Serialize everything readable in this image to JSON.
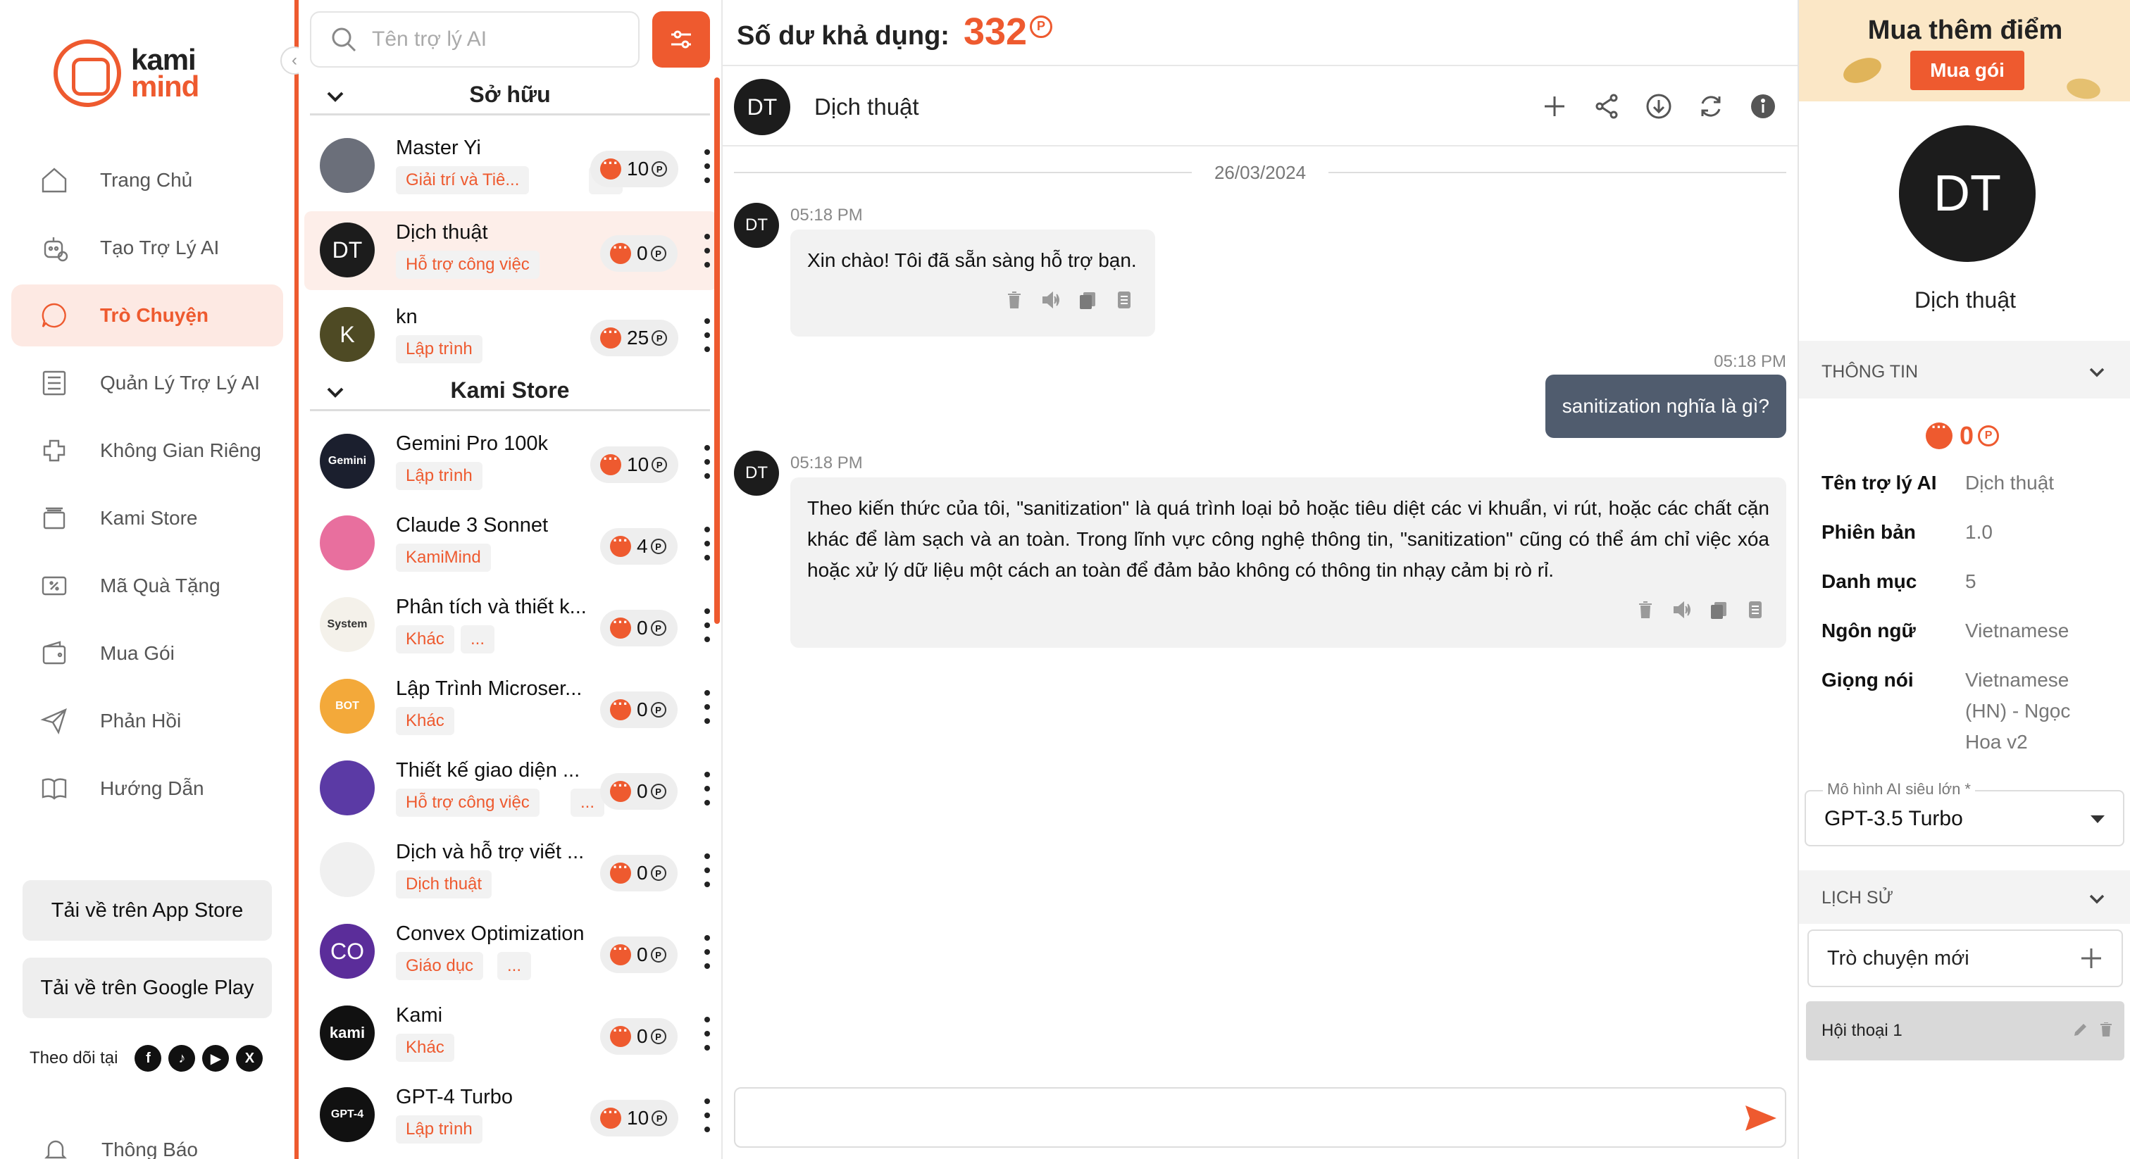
{
  "nav": {
    "logo_top": "kami",
    "logo_bottom": "mind",
    "items": [
      {
        "label": "Trang Chủ",
        "icon": "home-icon",
        "active": false
      },
      {
        "label": "Tạo Trợ Lý AI",
        "icon": "robot-icon",
        "active": false
      },
      {
        "label": "Trò Chuyện",
        "icon": "chat-icon",
        "active": true
      },
      {
        "label": "Quản Lý Trợ Lý AI",
        "icon": "list-icon",
        "active": false
      },
      {
        "label": "Không Gian Riêng",
        "icon": "puzzle-icon",
        "active": false
      },
      {
        "label": "Kami Store",
        "icon": "store-icon",
        "active": false
      },
      {
        "label": "Mã Quà Tặng",
        "icon": "voucher-icon",
        "active": false
      },
      {
        "label": "Mua Gói",
        "icon": "wallet-icon",
        "active": false
      },
      {
        "label": "Phản Hồi",
        "icon": "send-icon",
        "active": false
      },
      {
        "label": "Hướng Dẫn",
        "icon": "book-icon",
        "active": false
      }
    ],
    "app_store": "Tải về trên App Store",
    "google_play": "Tải về trên Google Play",
    "follow_label": "Theo dõi tại",
    "notification": "Thông Báo"
  },
  "assistants": {
    "search_placeholder": "Tên trợ lý AI",
    "owned_title": "Sở hữu",
    "store_title": "Kami Store",
    "owned": [
      {
        "name": "Master Yi",
        "tags": [
          "Giải trí và Tiê...",
          "..."
        ],
        "count": "10",
        "avatar": "",
        "av_color": "#6b6f7a"
      },
      {
        "name": "Dịch thuật",
        "tags": [
          "Hỗ trợ công việc"
        ],
        "count": "0",
        "avatar": "DT",
        "av_color": "#1c1c1c",
        "active": true
      },
      {
        "name": "kn",
        "tags": [
          "Lập trình"
        ],
        "count": "25",
        "avatar": "K",
        "av_color": "#4e4a24"
      }
    ],
    "store": [
      {
        "name": "Gemini Pro 100k",
        "tags": [
          "Lập trình"
        ],
        "count": "10",
        "avatar": "Gemini",
        "av_color": "#1b1f2e"
      },
      {
        "name": "Claude 3 Sonnet",
        "tags": [
          "KamiMind"
        ],
        "count": "4",
        "avatar": "",
        "av_color": "#e86f9e"
      },
      {
        "name": "Phân tích và thiết k...",
        "tags": [
          "Khác",
          "..."
        ],
        "count": "0",
        "avatar": "System",
        "av_color": "#f4f1ea"
      },
      {
        "name": "Lập Trình Microser...",
        "tags": [
          "Khác"
        ],
        "count": "0",
        "avatar": "BOT",
        "av_color": "#f3a93a"
      },
      {
        "name": "Thiết kế giao diện ...",
        "tags": [
          "Hỗ trợ công việc",
          "..."
        ],
        "count": "0",
        "avatar": "",
        "av_color": "#5b3aa5"
      },
      {
        "name": "Dịch và hỗ trợ viết ...",
        "tags": [
          "Dịch thuật"
        ],
        "count": "0",
        "avatar": "",
        "av_color": "#f0f0f0"
      },
      {
        "name": "Convex Optimization",
        "tags": [
          "Giáo dục",
          "..."
        ],
        "count": "0",
        "avatar": "CO",
        "av_color": "#5b2d9a"
      },
      {
        "name": "Kami",
        "tags": [
          "Khác"
        ],
        "count": "0",
        "avatar": "kami",
        "av_color": "#111111"
      },
      {
        "name": "GPT-4 Turbo",
        "tags": [
          "Lập trình"
        ],
        "count": "10",
        "avatar": "GPT-4",
        "av_color": "#111111"
      }
    ]
  },
  "chat": {
    "balance_label": "Số dư khả dụng:",
    "balance_value": "332",
    "coin_symbol": "P",
    "title": "Dịch thuật",
    "avatar": "DT",
    "date": "26/03/2024",
    "messages": [
      {
        "role": "bot",
        "time": "05:18 PM",
        "text": "Xin chào! Tôi đã sẵn sàng hỗ trợ bạn."
      },
      {
        "role": "user",
        "time": "05:18 PM",
        "text": "sanitization nghĩa là gì?"
      },
      {
        "role": "bot",
        "time": "05:18 PM",
        "text": "Theo kiến thức của tôi, \"sanitization\" là quá trình loại bỏ hoặc tiêu diệt các vi khuẩn, vi rút, hoặc các chất cặn khác để làm sạch và an toàn. Trong lĩnh vực công nghệ thông tin, \"sanitization\" cũng có thể ám chỉ việc xóa hoặc xử lý dữ liệu một cách an toàn để đảm bảo không có thông tin nhạy cảm bị rò rỉ."
      }
    ],
    "input_value": ""
  },
  "panel": {
    "promo_title": "Mua thêm điểm",
    "buy_button": "Mua gói",
    "avatar": "DT",
    "name": "Dịch thuật",
    "info_title": "THÔNG TIN",
    "cost": "0",
    "fields": [
      {
        "key": "Tên trợ lý AI",
        "value": "Dịch thuật"
      },
      {
        "key": "Phiên bản",
        "value": "1.0"
      },
      {
        "key": "Danh mục",
        "value": "5"
      },
      {
        "key": "Ngôn ngữ",
        "value": "Vietnamese"
      },
      {
        "key": "Giọng nói",
        "value": "Vietnamese (HN) - Ngọc Hoa v2"
      }
    ],
    "model_label": "Mô hình AI siêu lớn *",
    "model_value": "GPT-3.5 Turbo",
    "history_title": "LỊCH SỬ",
    "new_chat": "Trò chuyện mới",
    "conversations": [
      "Hội thoại 1"
    ]
  },
  "colors": {
    "accent": "#ee5a2f",
    "user_bubble": "#505c6e",
    "dark_avatar": "#1c1c1c"
  }
}
